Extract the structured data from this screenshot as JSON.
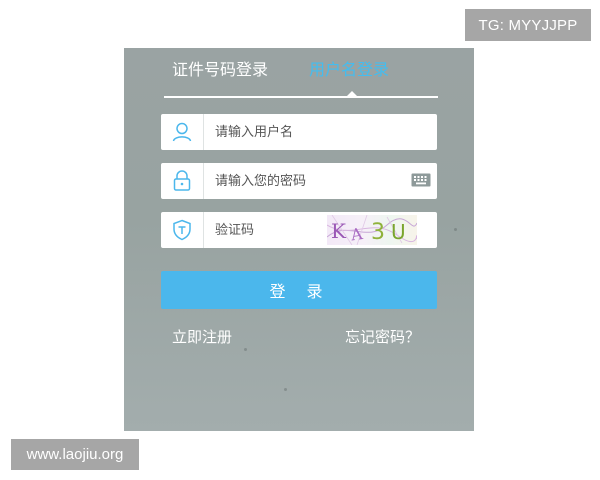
{
  "watermarks": {
    "top_right": "TG: MYYJJPP",
    "bottom_left": "www.laojiu.org"
  },
  "tabs": [
    {
      "label": "证件号码登录",
      "active": false
    },
    {
      "label": "用户名登录",
      "active": true
    }
  ],
  "fields": {
    "username": {
      "placeholder": "请输入用户名",
      "icon": "user-icon"
    },
    "password": {
      "placeholder": "请输入您的密码",
      "icon": "lock-icon",
      "extra_icon": "keyboard-icon"
    },
    "captcha": {
      "placeholder": "验证码",
      "icon": "shield-icon",
      "captcha_text": "KA3U"
    }
  },
  "login_button": "登 录",
  "links": {
    "register": "立即注册",
    "forgot": "忘记密码？"
  },
  "colors": {
    "panel": "#9aa3a3",
    "accent": "#43bdf0",
    "button": "#4bb7ec"
  }
}
